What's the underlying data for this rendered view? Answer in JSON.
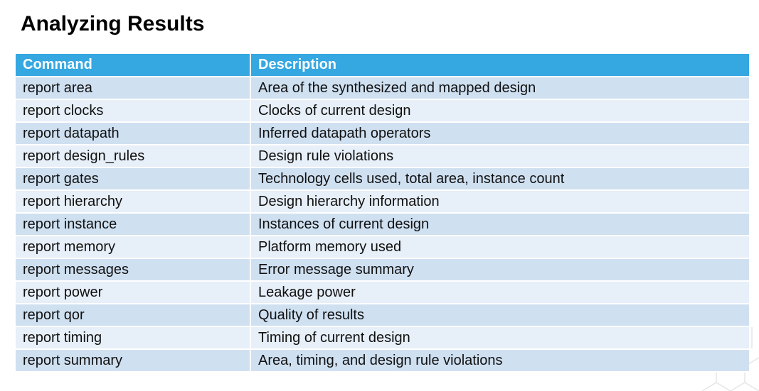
{
  "page": {
    "title": "Analyzing Results"
  },
  "table": {
    "headers": [
      "Command",
      "Description"
    ],
    "rows": [
      [
        "report area",
        "Area of the synthesized and mapped design"
      ],
      [
        "report clocks",
        "Clocks of current design"
      ],
      [
        "report datapath",
        "Inferred datapath operators"
      ],
      [
        "report design_rules",
        "Design rule violations"
      ],
      [
        "report gates",
        "Technology cells used, total area, instance count"
      ],
      [
        "report hierarchy",
        "Design hierarchy information"
      ],
      [
        "report instance",
        "Instances of current design"
      ],
      [
        "report memory",
        "Platform memory used"
      ],
      [
        "report messages",
        "Error message summary"
      ],
      [
        "report power",
        "Leakage power"
      ],
      [
        "report qor",
        "Quality of results"
      ],
      [
        "report timing",
        "Timing of current design"
      ],
      [
        "report summary",
        "Area, timing, and design rule violations"
      ]
    ]
  },
  "colors": {
    "header_bg": "#35a7e1",
    "row_dark": "#cfe0f1",
    "row_light": "#e7eff8"
  },
  "icons": {
    "background_decoration": "hexagon-pattern"
  }
}
